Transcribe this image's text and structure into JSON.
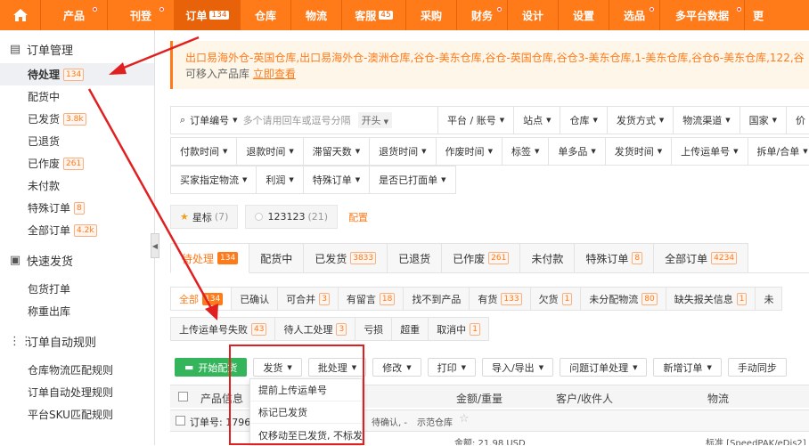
{
  "top_nav": {
    "items": [
      {
        "label": "产品",
        "dot": true,
        "count": "",
        "active": false
      },
      {
        "label": "刊登",
        "dot": true,
        "count": "",
        "active": false
      },
      {
        "label": "订单",
        "dot": false,
        "count": "134",
        "active": true
      },
      {
        "label": "仓库",
        "dot": false,
        "count": "",
        "active": false
      },
      {
        "label": "物流",
        "dot": false,
        "count": "",
        "active": false
      },
      {
        "label": "客服",
        "dot": false,
        "count": "45",
        "active": false
      },
      {
        "label": "采购",
        "dot": false,
        "count": "",
        "active": false
      },
      {
        "label": "财务",
        "dot": true,
        "count": "",
        "active": false
      },
      {
        "label": "设计",
        "dot": false,
        "count": "",
        "active": false
      },
      {
        "label": "设置",
        "dot": false,
        "count": "",
        "active": false
      },
      {
        "label": "选品",
        "dot": true,
        "count": "",
        "active": false
      },
      {
        "label": "多平台数据",
        "dot": true,
        "count": "",
        "active": false
      },
      {
        "label": "更",
        "dot": false,
        "count": "",
        "active": false
      }
    ]
  },
  "sidebar": {
    "groups": [
      {
        "title": "订单管理",
        "icon": "document-icon",
        "items": [
          {
            "label": "待处理",
            "badge": "134",
            "active": true
          },
          {
            "label": "配货中",
            "badge": "",
            "active": false
          },
          {
            "label": "已发货",
            "badge": "3.8k",
            "active": false
          },
          {
            "label": "已退货",
            "badge": "",
            "active": false
          },
          {
            "label": "已作废",
            "badge": "261",
            "active": false
          },
          {
            "label": "未付款",
            "badge": "",
            "active": false
          },
          {
            "label": "特殊订单",
            "badge": "8",
            "active": false
          },
          {
            "label": "全部订单",
            "badge": "4.2k",
            "active": false
          }
        ]
      },
      {
        "title": "快速发货",
        "icon": "box-icon",
        "items": [
          {
            "label": "包货打单",
            "badge": "",
            "active": false
          },
          {
            "label": "称重出库",
            "badge": "",
            "active": false
          }
        ]
      },
      {
        "title": "订单自动规则",
        "icon": "grid-icon",
        "items": [
          {
            "label": "仓库物流匹配规则",
            "badge": "",
            "active": false
          },
          {
            "label": "订单自动处理规则",
            "badge": "",
            "active": false
          },
          {
            "label": "平台SKU匹配规则",
            "badge": "",
            "active": false
          }
        ]
      }
    ]
  },
  "notice": {
    "text": "出口易海外仓-英国仓库,出口易海外仓-澳洲仓库,谷仓-美东仓库,谷仓-英国仓库,谷仓3-美东仓库,1-美东仓库,谷仓6-美东仓库,122,谷",
    "line2_prefix": "可移入产品库",
    "link": "立即查看"
  },
  "filters": {
    "search_label": "订单编号",
    "search_placeholder": "多个请用回车或逗号分隔",
    "match_mode": "开头",
    "row1": [
      "平台 / 账号",
      "站点",
      "仓库",
      "发货方式",
      "物流渠道",
      "国家",
      "价"
    ],
    "row2": [
      "付款时间",
      "退款时间",
      "滞留天数",
      "退货时间",
      "作废时间",
      "标签",
      "单多品",
      "发货时间",
      "上传运单号",
      "拆单/合单"
    ],
    "row3": [
      "买家指定物流",
      "利润",
      "特殊订单",
      "是否已打面单"
    ]
  },
  "tags": [
    {
      "label": "星标",
      "count": "(7)",
      "icon": "star-icon"
    },
    {
      "label": "123123",
      "count": "(21)",
      "icon": "circle-icon"
    }
  ],
  "tags_link": "配置",
  "main_tabs": [
    {
      "label": "待处理",
      "badge": "134",
      "active": true
    },
    {
      "label": "配货中",
      "badge": "",
      "active": false
    },
    {
      "label": "已发货",
      "badge": "3833",
      "active": false
    },
    {
      "label": "已退货",
      "badge": "",
      "active": false
    },
    {
      "label": "已作废",
      "badge": "261",
      "active": false
    },
    {
      "label": "未付款",
      "badge": "",
      "active": false
    },
    {
      "label": "特殊订单",
      "badge": "8",
      "active": false
    },
    {
      "label": "全部订单",
      "badge": "4234",
      "active": false
    }
  ],
  "sub_tabs_row1": [
    {
      "label": "全部",
      "badge": "134",
      "active": true
    },
    {
      "label": "已确认",
      "badge": "",
      "active": false
    },
    {
      "label": "可合并",
      "badge": "3",
      "active": false
    },
    {
      "label": "有留言",
      "badge": "18",
      "active": false
    },
    {
      "label": "找不到产品",
      "badge": "",
      "active": false
    },
    {
      "label": "有货",
      "badge": "133",
      "active": false
    },
    {
      "label": "欠货",
      "badge": "1",
      "active": false
    },
    {
      "label": "未分配物流",
      "badge": "80",
      "active": false
    },
    {
      "label": "缺失报关信息",
      "badge": "1",
      "active": false
    },
    {
      "label": "未",
      "badge": "",
      "active": false
    }
  ],
  "sub_tabs_row2": [
    {
      "label": "上传运单号失败",
      "badge": "43"
    },
    {
      "label": "待人工处理",
      "badge": "3"
    },
    {
      "label": "亏损",
      "badge": ""
    },
    {
      "label": "超重",
      "badge": ""
    },
    {
      "label": "取消中",
      "badge": "1"
    }
  ],
  "actions": {
    "start_ship": "开始配货",
    "ship": "发货",
    "batch": "批处理",
    "modify": "修改",
    "print": "打印",
    "import_export": "导入/导出",
    "problem_order": "问题订单处理",
    "new_order": "新增订单",
    "manual_sync": "手动同步"
  },
  "dropdown": [
    "提前上传运单号",
    "标记已发货",
    "仅移动至已发货, 不标发"
  ],
  "table": {
    "headers": {
      "product": "产品信息",
      "amount": "金额/重量",
      "customer": "客户/收件人",
      "logistics": "物流"
    },
    "order_row": {
      "order_no": "订单号: 17965",
      "status": "待确认, -",
      "warehouse": "示范仓库"
    },
    "peek": {
      "amount": "金额: 21.98 USD",
      "logistics": "标准 [SpeedPAK/eDis2]"
    }
  },
  "colors": {
    "brand": "#ff7a19",
    "annotation": "#e02020",
    "green": "#35b55b"
  }
}
